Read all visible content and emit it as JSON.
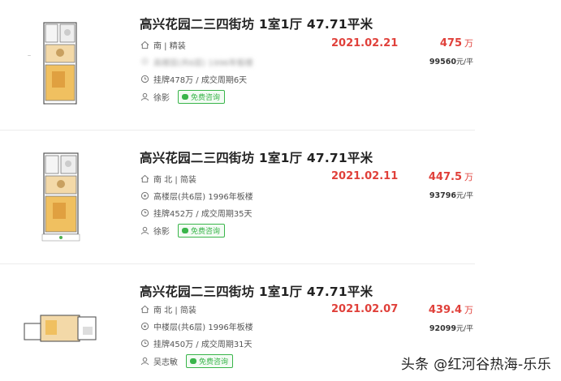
{
  "listings": [
    {
      "title": "高兴花园二三四街坊 1室1厅 47.71平米",
      "orientation": "南 | 精装",
      "floor_info": "高楼层(共6层) 1996年板楼",
      "listing_info": "挂牌478万 / 成交周期6天",
      "agent": "徐影",
      "consult_label": "免费咨询",
      "deal_date": "2021.02.21",
      "total_price": "475",
      "price_unit": "万",
      "unit_price": "99560",
      "unit_price_suffix": "元/平"
    },
    {
      "title": "高兴花园二三四街坊 1室1厅 47.71平米",
      "orientation": "南 北 | 简装",
      "floor_info": "高楼层(共6层) 1996年板楼",
      "listing_info": "挂牌452万 / 成交周期35天",
      "agent": "徐影",
      "consult_label": "免费咨询",
      "deal_date": "2021.02.11",
      "total_price": "447.5",
      "price_unit": "万",
      "unit_price": "93796",
      "unit_price_suffix": "元/平"
    },
    {
      "title": "高兴花园二三四街坊 1室1厅 47.71平米",
      "orientation": "南 北 | 简装",
      "floor_info": "中楼层(共6层) 1996年板楼",
      "listing_info": "挂牌450万 / 成交周期31天",
      "agent": "吴志敏",
      "consult_label": "免费咨询",
      "deal_date": "2021.02.07",
      "total_price": "439.4",
      "price_unit": "万",
      "unit_price": "92099",
      "unit_price_suffix": "元/平"
    }
  ],
  "watermark": "头条 @红河谷热海-乐乐",
  "colors": {
    "price_red": "#e0403a",
    "consult_green": "#39b54a",
    "divider": "#ececec"
  },
  "icons": {
    "orientation": "house-icon",
    "floor": "location-pin-icon",
    "listing": "clock-icon",
    "agent": "person-icon",
    "consult": "chat-bubble-icon"
  }
}
